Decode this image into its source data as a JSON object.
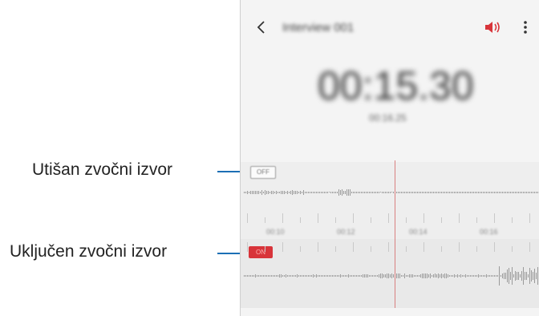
{
  "callouts": {
    "muted_label": "Utišan zvočni izvor",
    "enabled_label": "Uključen zvočni izvor"
  },
  "toolbar": {
    "title": "Interview 001",
    "back_icon": "chevron-left-icon",
    "speaker_icon": "speaker-icon",
    "more_icon": "more-vertical-icon"
  },
  "player": {
    "elapsed": "00:15.30",
    "total": "00:16.25"
  },
  "tracks": {
    "top_chip": "OFF",
    "bottom_chip": "ON"
  },
  "timeline": {
    "labels": [
      "00:10",
      "00:12",
      "00:14",
      "00:16"
    ]
  },
  "colors": {
    "accent": "#d8343a",
    "leader": "#1c6fb5",
    "playhead": "#d98080"
  }
}
